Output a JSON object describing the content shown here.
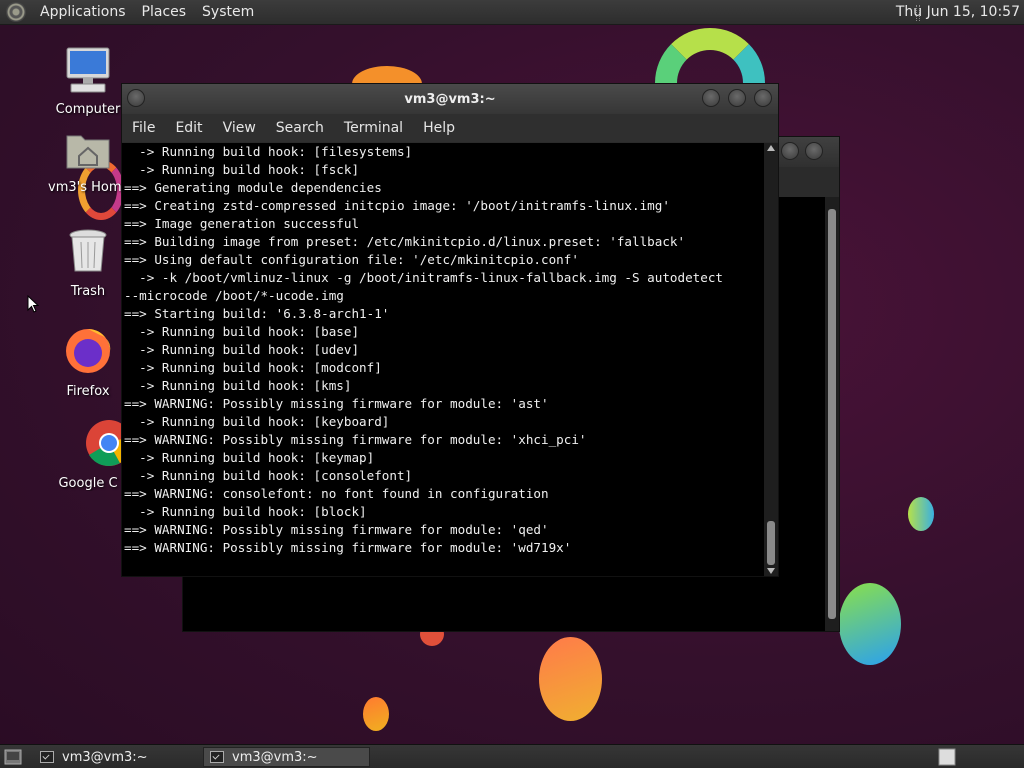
{
  "top_panel": {
    "menus": [
      "Applications",
      "Places",
      "System"
    ],
    "clock": "Thu Jun 15, 10:57"
  },
  "desktop_icons": [
    {
      "label": "Computer",
      "icon": "computer-icon"
    },
    {
      "label": "vm3's Home",
      "icon": "home-folder-icon"
    },
    {
      "label": "Trash",
      "icon": "trash-icon"
    },
    {
      "label": "Firefox",
      "icon": "firefox-icon"
    },
    {
      "label": "Google C",
      "icon": "chrome-icon"
    }
  ],
  "terminal": {
    "title": "vm3@vm3:~",
    "menus": [
      "File",
      "Edit",
      "View",
      "Search",
      "Terminal",
      "Help"
    ],
    "lines": [
      "  -> Running build hook: [filesystems]",
      "  -> Running build hook: [fsck]",
      "==> Generating module dependencies",
      "==> Creating zstd-compressed initcpio image: '/boot/initramfs-linux.img'",
      "==> Image generation successful",
      "==> Building image from preset: /etc/mkinitcpio.d/linux.preset: 'fallback'",
      "==> Using default configuration file: '/etc/mkinitcpio.conf'",
      "  -> -k /boot/vmlinuz-linux -g /boot/initramfs-linux-fallback.img -S autodetect",
      "--microcode /boot/*-ucode.img",
      "==> Starting build: '6.3.8-arch1-1'",
      "  -> Running build hook: [base]",
      "  -> Running build hook: [udev]",
      "  -> Running build hook: [modconf]",
      "  -> Running build hook: [kms]",
      "==> WARNING: Possibly missing firmware for module: 'ast'",
      "  -> Running build hook: [keyboard]",
      "==> WARNING: Possibly missing firmware for module: 'xhci_pci'",
      "  -> Running build hook: [keymap]",
      "  -> Running build hook: [consolefont]",
      "==> WARNING: consolefont: no font found in configuration",
      "  -> Running build hook: [block]",
      "==> WARNING: Possibly missing firmware for module: 'qed'",
      "==> WARNING: Possibly missing firmware for module: 'wd719x'"
    ]
  },
  "taskbar": {
    "tasks": [
      "vm3@vm3:~",
      "vm3@vm3:~"
    ]
  },
  "colors": {
    "desktop_bg": "#3b1030",
    "panel_bg": "#2d2d2d",
    "terminal_bg": "#000000",
    "terminal_fg": "#f0f0f0"
  }
}
